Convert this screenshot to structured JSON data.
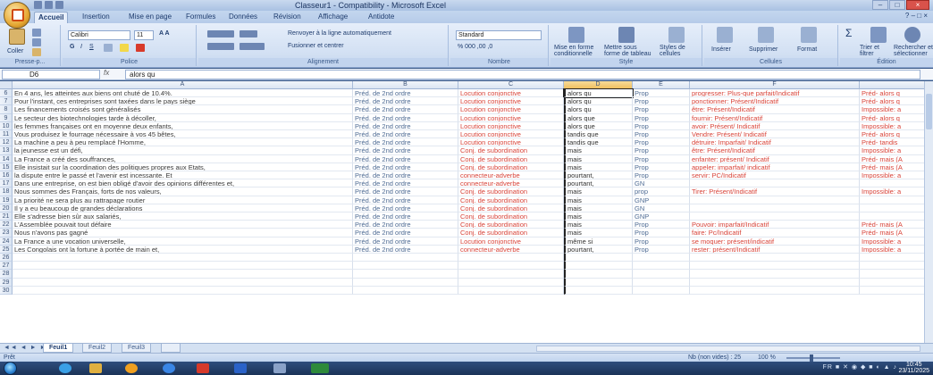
{
  "window": {
    "title": "Classeur1 - Compatibility - Microsoft Excel",
    "controls": [
      "–",
      "□",
      "×"
    ]
  },
  "ribbon_tabs": [
    "Accueil",
    "Insertion",
    "Mise en page",
    "Formules",
    "Données",
    "Révision",
    "Affichage",
    "Antidote"
  ],
  "ribbon": {
    "clipboard": {
      "paste": "Coller",
      "label": "Presse-p..."
    },
    "font": {
      "name": "Calibri",
      "size": "11",
      "label": "Police"
    },
    "alignment": {
      "wrap": "Renvoyer à la ligne automatiquement",
      "merge": "Fusionner et centrer",
      "label": "Alignement"
    },
    "number": {
      "format": "Standard",
      "label": "Nombre"
    },
    "style": {
      "conditional": "Mise en forme conditionnelle",
      "table": "Mettre sous forme de tableau",
      "cell_styles": "Styles de cellules",
      "label": "Style"
    },
    "cells": {
      "insert": "Insérer",
      "delete": "Supprimer",
      "format": "Format",
      "label": "Cellules"
    },
    "editing": {
      "sort": "Trier et filtrer",
      "find": "Rechercher et sélectionner",
      "label": "Édition"
    }
  },
  "formula_bar": {
    "cell_ref": "D6",
    "fx": "fx",
    "content": "alors qu"
  },
  "columns": [
    "A",
    "B",
    "C",
    "D",
    "E",
    "F"
  ],
  "rows": [
    {
      "n": "6",
      "a": "En 4 ans, les atteintes aux biens ont chuté de 10.4%.",
      "b": "Préd. de 2nd ordre",
      "c": "Locution conjonctive",
      "d": "alors qu",
      "e": "Prop",
      "f": "progresser: Plus-que parfait/Indicatif",
      "g": "Préd- alors q"
    },
    {
      "n": "7",
      "a": "Pour l'instant, ces entreprises sont taxées dans le pays siège",
      "b": "Préd. de 2nd ordre",
      "c": "Locution conjonctive",
      "d": "alors qu",
      "e": "Prop",
      "f": "ponctionner: Présent/Indicatif",
      "g": "Préd- alors q"
    },
    {
      "n": "8",
      "a": "Les financements croisés sont généralisés",
      "b": "Préd. de 2nd ordre",
      "c": "Locution conjonctive",
      "d": "alors qu",
      "e": "Prop",
      "f": "être: Présent/Indicatif",
      "g": "Impossible: a"
    },
    {
      "n": "9",
      "a": "Le secteur des biotechnologies tarde à décoller,",
      "b": "Préd. de 2nd ordre",
      "c": "Locution conjonctive",
      "d": "alors que",
      "e": "Prop",
      "f": "fournir: Présent/Indicatif",
      "g": "Préd- alors q"
    },
    {
      "n": "10",
      "a": "les femmes françaises ont en moyenne deux enfants,",
      "b": "Préd. de 2nd ordre",
      "c": "Locution conjonctive",
      "d": "alors que",
      "e": "Prop",
      "f": "avoir: Présent/ Indicatif",
      "g": "Impossible: a"
    },
    {
      "n": "11",
      "a": "Vous produisez le fourrage nécessaire à vos 45 bêtes,",
      "b": "Préd. de 2nd ordre",
      "c": "Locution conjonctive",
      "d": "tandis que",
      "e": "Prop",
      "f": "Vendre: Présent/ Indicatif",
      "g": "Préd- alors q"
    },
    {
      "n": "12",
      "a": "La machine a peu à peu remplacé l'Homme,",
      "b": "Préd. de 2nd ordre",
      "c": "Locution conjonctive",
      "d": "tandis que",
      "e": "Prop",
      "f": "détruire: Imparfait/ Indicatif",
      "g": "Préd- tandis"
    },
    {
      "n": "13",
      "a": "la jeunesse est un défi,",
      "b": "Préd. de 2nd ordre",
      "c": "Conj. de subordination",
      "d": "mais",
      "e": "Prop",
      "f": "être: Présent/Indicatif",
      "g": "Impossible: a"
    },
    {
      "n": "14",
      "a": "La France a créé des souffrances,",
      "b": "Préd. de 2nd ordre",
      "c": "Conj. de subordination",
      "d": "mais",
      "e": "Prop",
      "f": "enfanter: présent/ Indicatif",
      "g": "Préd- mais (A"
    },
    {
      "n": "15",
      "a": "Elle insistait sur la coordination des politiques propres aux Etats,",
      "b": "Préd. de 2nd ordre",
      "c": "Conj. de subordination",
      "d": "mais",
      "e": "Prop",
      "f": "appeler: imparfait/ indicatif",
      "g": "Préd- mais (A"
    },
    {
      "n": "16",
      "a": "la dispute entre le passé et l'avenir est incessante. Et",
      "b": "Préd. de 2nd ordre",
      "c": "connecteur-adverbe",
      "d": "pourtant,",
      "e": "Prop",
      "f": "servir: PC/Indicatif",
      "g": "Impossible: a"
    },
    {
      "n": "17",
      "a": "Dans une entreprise, on est bien obligé d'avoir des opinions différentes et,",
      "b": "Préd. de 2nd ordre",
      "c": "connecteur-adverbe",
      "d": "pourtant,",
      "e": "GN",
      "f": "",
      "g": ""
    },
    {
      "n": "18",
      "a": "Nous sommes des Français, forts de nos valeurs,",
      "b": "Préd. de 2nd ordre",
      "c": "Conj. de subordination",
      "d": "mais",
      "e": "prop",
      "f": "Tirer: Présent/Indicatif",
      "g": "Impossible: a"
    },
    {
      "n": "19",
      "a": "La priorité ne sera plus au rattrapage routier",
      "b": "Préd. de 2nd ordre",
      "c": "Conj. de subordination",
      "d": "mais",
      "e": "GNP",
      "f": "",
      "g": ""
    },
    {
      "n": "20",
      "a": "Il y a eu beaucoup de grandes déclarations",
      "b": "Préd. de 2nd ordre",
      "c": "Conj. de subordination",
      "d": "mais",
      "e": "GN",
      "f": "",
      "g": ""
    },
    {
      "n": "21",
      "a": "Elle s'adresse bien sûr aux salariés,",
      "b": "Préd. de 2nd ordre",
      "c": "Conj. de subordination",
      "d": "mais",
      "e": "GNP",
      "f": "",
      "g": ""
    },
    {
      "n": "22",
      "a": "L'Assemblée pouvait tout défaire",
      "b": "Préd. de 2nd ordre",
      "c": "Conj. de subordination",
      "d": "mais",
      "e": "Prop",
      "f": "Pouvoir: imparfait/Indicatif",
      "g": "Préd- mais (A"
    },
    {
      "n": "23",
      "a": "Nous n'avons pas gagné",
      "b": "Préd. de 2nd ordre",
      "c": "Conj. de subordination",
      "d": "mais",
      "e": "Prop",
      "f": "faire: Pc/Indicatif",
      "g": "Préd- mais (A"
    },
    {
      "n": "24",
      "a": "La France a une vocation universelle,",
      "b": "Préd. de 2nd ordre",
      "c": "Locution conjonctive",
      "d": "même si",
      "e": "Prop",
      "f": "se moquer: présent/indicatif",
      "g": "Impossible: a"
    },
    {
      "n": "25",
      "a": "Les Congolais ont la fortune à portée de main et,",
      "b": "Préd. de 2nd ordre",
      "c": "connecteur-adverbe",
      "d": "pourtant,",
      "e": "Prop",
      "f": "rester: présent/Indicatif",
      "g": "Impossible: a"
    },
    {
      "n": "26",
      "a": "",
      "b": "",
      "c": "",
      "d": "",
      "e": "",
      "f": "",
      "g": ""
    },
    {
      "n": "27",
      "a": "",
      "b": "",
      "c": "",
      "d": "",
      "e": "",
      "f": "",
      "g": ""
    },
    {
      "n": "28",
      "a": "",
      "b": "",
      "c": "",
      "d": "",
      "e": "",
      "f": "",
      "g": ""
    },
    {
      "n": "29",
      "a": "",
      "b": "",
      "c": "",
      "d": "",
      "e": "",
      "f": "",
      "g": ""
    },
    {
      "n": "30",
      "a": "",
      "b": "",
      "c": "",
      "d": "",
      "e": "",
      "f": "",
      "g": ""
    }
  ],
  "sheets": [
    "Feuil1",
    "Feuil2",
    "Feuil3"
  ],
  "status": {
    "mode": "Prêt",
    "count": "Nb (non vides) : 25",
    "zoom": "100 %"
  },
  "taskbar": {
    "time": "10:45",
    "date": "23/11/2025"
  }
}
